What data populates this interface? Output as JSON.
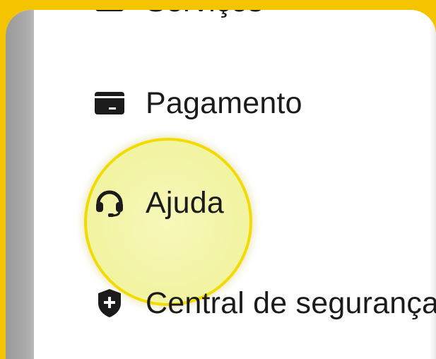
{
  "menu": {
    "items": [
      {
        "label": "Serviços",
        "icon": "box-icon"
      },
      {
        "label": "Pagamento",
        "icon": "wallet-icon"
      },
      {
        "label": "Ajuda",
        "icon": "headset-icon"
      },
      {
        "label": "Central de segurança",
        "icon": "shield-plus-icon"
      }
    ]
  },
  "colors": {
    "background_accent": "#f5c400",
    "highlight_fill": "#f4f5a8",
    "highlight_ring": "#f2db00",
    "text": "#1b1b1b"
  }
}
